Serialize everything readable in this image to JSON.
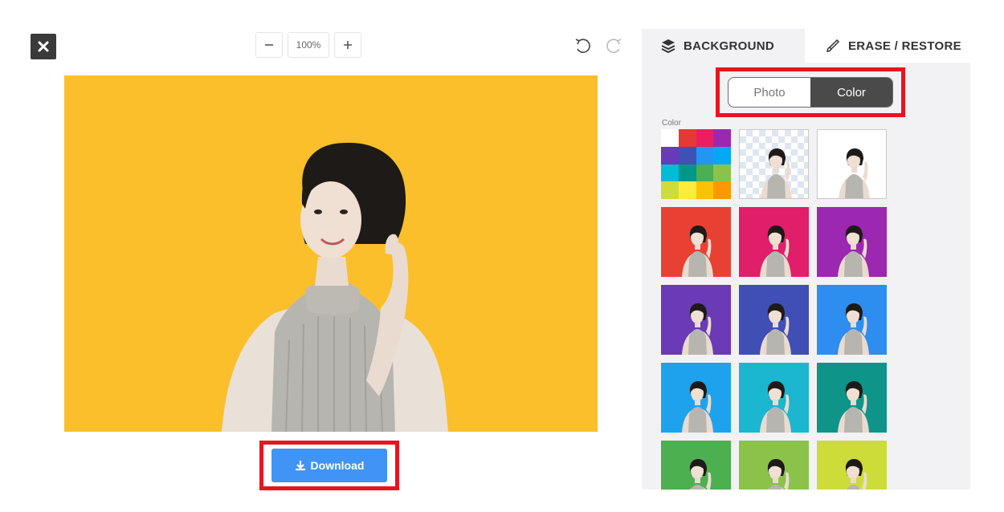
{
  "toolbar": {
    "zoom_value": "100%"
  },
  "tabs": [
    {
      "label": "BACKGROUND",
      "icon": "layers-icon"
    },
    {
      "label": "ERASE / RESTORE",
      "icon": "brush-icon"
    }
  ],
  "mode_toggle": {
    "options": [
      "Photo",
      "Color"
    ],
    "selected": "Color"
  },
  "palette": {
    "label": "Color"
  },
  "download": {
    "label": "Download"
  },
  "canvas": {
    "background_color": "#FBBF2B"
  },
  "palette_grid": [
    "#FFFFFF",
    "#E53935",
    "#E91E63",
    "#9C27B0",
    "#673AB7",
    "#3F51B5",
    "#2196F3",
    "#03A9F4",
    "#00BCD4",
    "#009688",
    "#4CAF50",
    "#8BC34A",
    "#CDDC39",
    "#FFEB3B",
    "#FFC107",
    "#FF9800"
  ],
  "swatches": [
    {
      "type": "palette"
    },
    {
      "type": "transparent"
    },
    {
      "type": "color",
      "color": "#FFFFFF"
    },
    {
      "type": "color",
      "color": "#E84134"
    },
    {
      "type": "color",
      "color": "#E01E6A"
    },
    {
      "type": "color",
      "color": "#9C27B0"
    },
    {
      "type": "color",
      "color": "#6A3AB7"
    },
    {
      "type": "color",
      "color": "#3F4FB5"
    },
    {
      "type": "color",
      "color": "#2D8EF0"
    },
    {
      "type": "color",
      "color": "#1FA2EE"
    },
    {
      "type": "color",
      "color": "#1BB6CF"
    },
    {
      "type": "color",
      "color": "#0E9488"
    },
    {
      "type": "color",
      "color": "#4CAF50"
    },
    {
      "type": "color",
      "color": "#8BC34A"
    },
    {
      "type": "color",
      "color": "#CDDC39"
    }
  ]
}
